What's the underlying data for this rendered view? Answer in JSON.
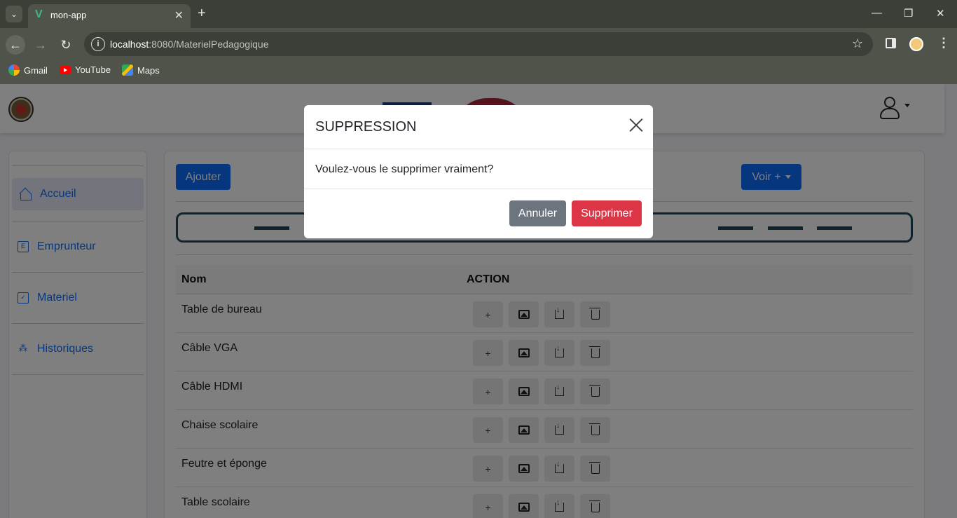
{
  "browser": {
    "tab_title": "mon-app",
    "url_host": "localhost",
    "url_path": ":8080/MaterielPedagogique",
    "bookmarks": [
      {
        "label": "Gmail",
        "icon": "gmail-icon"
      },
      {
        "label": "YouTube",
        "icon": "youtube-icon"
      },
      {
        "label": "Maps",
        "icon": "maps-icon"
      }
    ]
  },
  "sidebar": {
    "items": [
      {
        "label": "Accueil",
        "icon": "home-icon",
        "icon_text": ""
      },
      {
        "label": "Emprunteur",
        "icon": "e-box-icon",
        "icon_text": "E"
      },
      {
        "label": "Materiel",
        "icon": "clipboard-icon",
        "icon_text": "✓"
      },
      {
        "label": "Historiques",
        "icon": "sitemap-icon",
        "icon_text": "⁂"
      }
    ]
  },
  "toolbar": {
    "add_label": "Ajouter",
    "more_label": "Voir +"
  },
  "table": {
    "headers": [
      "Nom",
      "ACTION"
    ],
    "rows": [
      {
        "name": "Table de bureau"
      },
      {
        "name": "Câble VGA"
      },
      {
        "name": "Câble HDMI"
      },
      {
        "name": "Chaise scolaire"
      },
      {
        "name": "Feutre et éponge"
      },
      {
        "name": "Table scolaire"
      }
    ],
    "action_add_glyph": "+"
  },
  "modal": {
    "title": "SUPPRESSION",
    "message": "Voulez-vous le supprimer vraiment?",
    "cancel_label": "Annuler",
    "confirm_label": "Supprimer"
  },
  "colors": {
    "primary": "#0d6efd",
    "danger": "#dc3545",
    "secondary": "#6c757d",
    "chrome": "#4f534a"
  }
}
